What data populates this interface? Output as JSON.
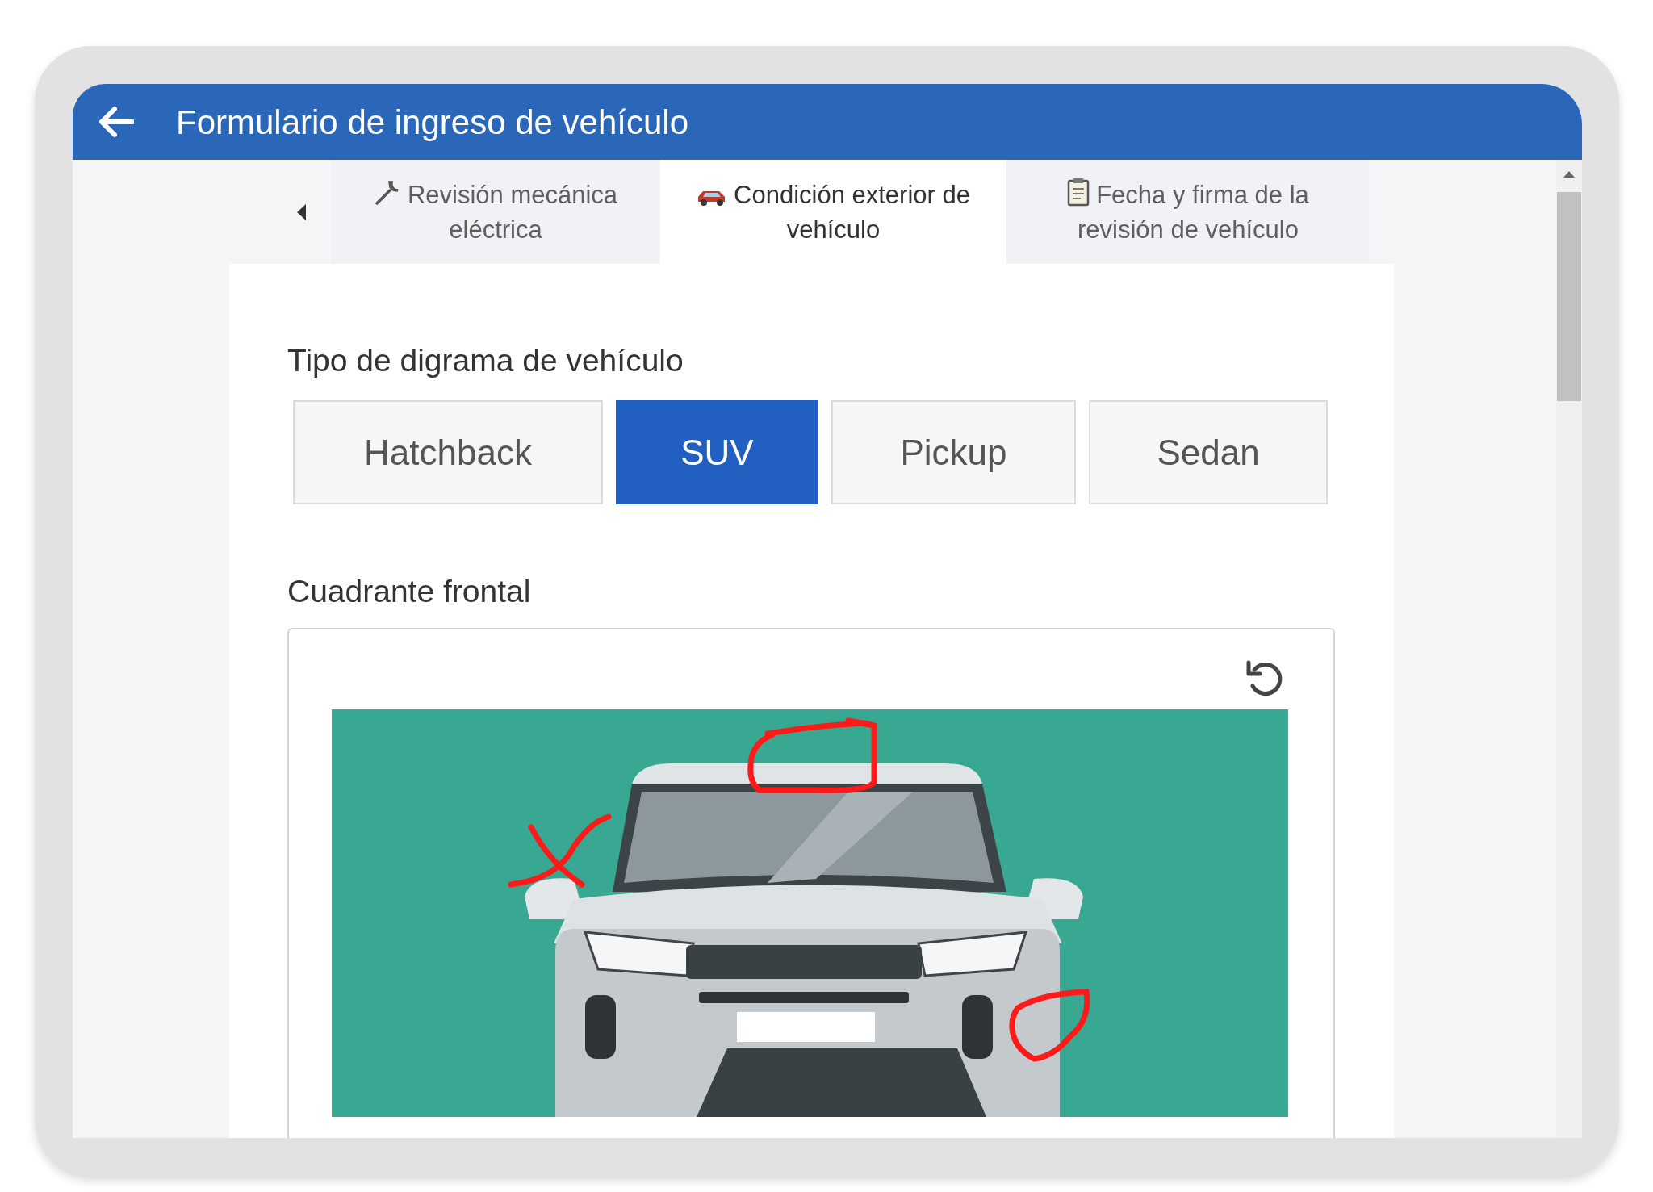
{
  "header": {
    "title": "Formulario de ingreso de vehículo"
  },
  "tabs": [
    {
      "kind": "wrench",
      "label": "Revisión mecánica eléctrica",
      "selected": false
    },
    {
      "kind": "car",
      "label": "Condición exterior de vehículo",
      "selected": true
    },
    {
      "kind": "clipboard",
      "label": "Fecha y firma de la revisión de vehículo",
      "selected": false
    }
  ],
  "diagram_type": {
    "label": "Tipo de digrama de vehículo",
    "options": [
      {
        "label": "Hatchback",
        "selected": false
      },
      {
        "label": "SUV",
        "selected": true
      },
      {
        "label": "Pickup",
        "selected": false
      },
      {
        "label": "Sedan",
        "selected": false
      }
    ]
  },
  "section": {
    "label": "Cuadrante frontal"
  }
}
